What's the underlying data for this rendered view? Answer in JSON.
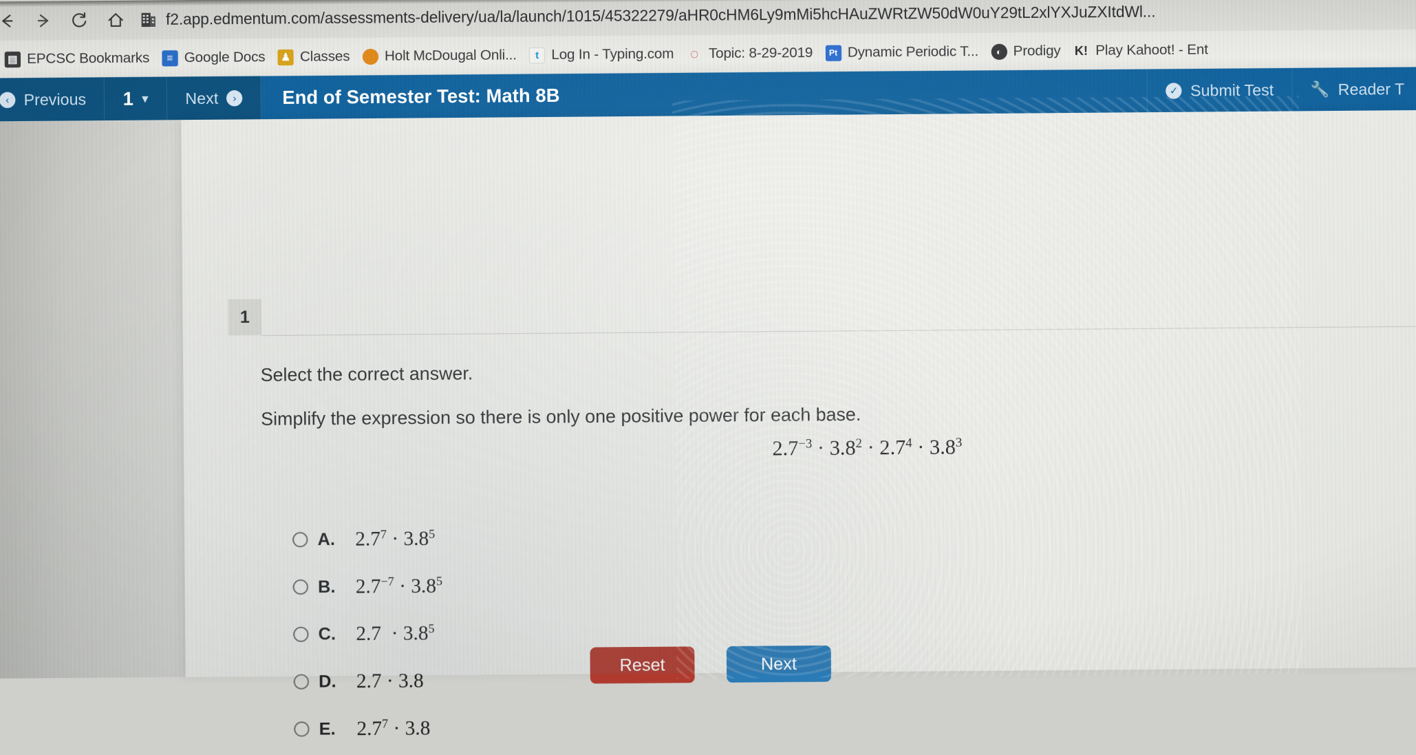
{
  "browser": {
    "nav": [
      {
        "name": "back",
        "glyph": "←"
      },
      {
        "name": "forward",
        "glyph": "→"
      },
      {
        "name": "reload",
        "glyph": "⟳"
      },
      {
        "name": "home",
        "glyph": "⌂"
      }
    ],
    "url": "f2.app.edmentum.com/assessments-delivery/ua/la/launch/1015/45322279/aHR0cHM6Ly9mMi5hcHAuZWRtZW50dW0uY29tL2xlYXJuZXItdWl...",
    "bookmarks": [
      {
        "label": "EPCSC Bookmarks",
        "icon": "folder-building-icon",
        "color": "#3d3f41",
        "text": "▤"
      },
      {
        "label": "Google Docs",
        "icon": "google-docs-icon",
        "color": "#2a6fc9",
        "text": "≡"
      },
      {
        "label": "Classes",
        "icon": "google-classroom-icon",
        "color": "#d9a520",
        "text": "♟"
      },
      {
        "label": "Holt McDougal Onli...",
        "icon": "holt-mcdougal-icon",
        "color": "#e08a1e",
        "text": ""
      },
      {
        "label": "Log In - Typing.com",
        "icon": "typing-com-icon",
        "color": "#2196d6",
        "text": "t"
      },
      {
        "label": "Topic: 8-29-2019",
        "icon": "topic-icon",
        "color": "#d0342c",
        "text": "◌"
      },
      {
        "label": "Dynamic Periodic T...",
        "icon": "periodic-table-icon",
        "color": "#2f6fd0",
        "text": "Pt"
      },
      {
        "label": "Prodigy",
        "icon": "prodigy-icon",
        "color": "#3a3b3d",
        "text": "◔"
      },
      {
        "label": "Play Kahoot! - Ent",
        "icon": "kahoot-icon",
        "color": "#46178f",
        "text": "K!"
      }
    ]
  },
  "toolbar": {
    "previous_label": "Previous",
    "previous_icon": "arrow-left-circle-icon",
    "question_number": "1",
    "dropdown_icon": "chevron-down-icon",
    "next_label": "Next",
    "next_icon": "arrow-right-circle-icon",
    "title": "End of Semester Test: Math 8B",
    "submit_label": "Submit Test",
    "submit_icon": "check-circle-icon",
    "reader_label": "Reader T",
    "reader_icon": "wrench-icon",
    "accent_color": "#12639e"
  },
  "question": {
    "number": "1",
    "instruction": "Select the correct answer.",
    "prompt": "Simplify the expression so there is only one positive power for each base.",
    "expression": {
      "parts": [
        {
          "base": "2.7",
          "exp": "−3"
        },
        {
          "base": "3.8",
          "exp": "2"
        },
        {
          "base": "2.7",
          "exp": "4"
        },
        {
          "base": "3.8",
          "exp": "3"
        }
      ],
      "plain": "2.7⁻³ · 3.8² · 2.7⁴ · 3.8³"
    },
    "options": [
      {
        "letter": "A.",
        "base1": "2.7",
        "exp1": "7",
        "base2": "3.8",
        "exp2": "5",
        "selected": false
      },
      {
        "letter": "B.",
        "base1": "2.7",
        "exp1": "−7",
        "base2": "3.8",
        "exp2": "5",
        "selected": false
      },
      {
        "letter": "C.",
        "base1": "2.7",
        "exp1": "",
        "base2": "3.8",
        "exp2": "5",
        "selected": false
      },
      {
        "letter": "D.",
        "base1": "2.7",
        "exp1": "",
        "base2": "3.8",
        "exp2": "",
        "selected": false
      },
      {
        "letter": "E.",
        "base1": "2.7",
        "exp1": "7",
        "base2": "3.8",
        "exp2": "",
        "selected": false
      }
    ],
    "separator": "·"
  },
  "footer": {
    "reset_label": "Reset",
    "next_label": "Next",
    "reset_color": "#b03a2e",
    "next_color": "#2a7ab5"
  }
}
